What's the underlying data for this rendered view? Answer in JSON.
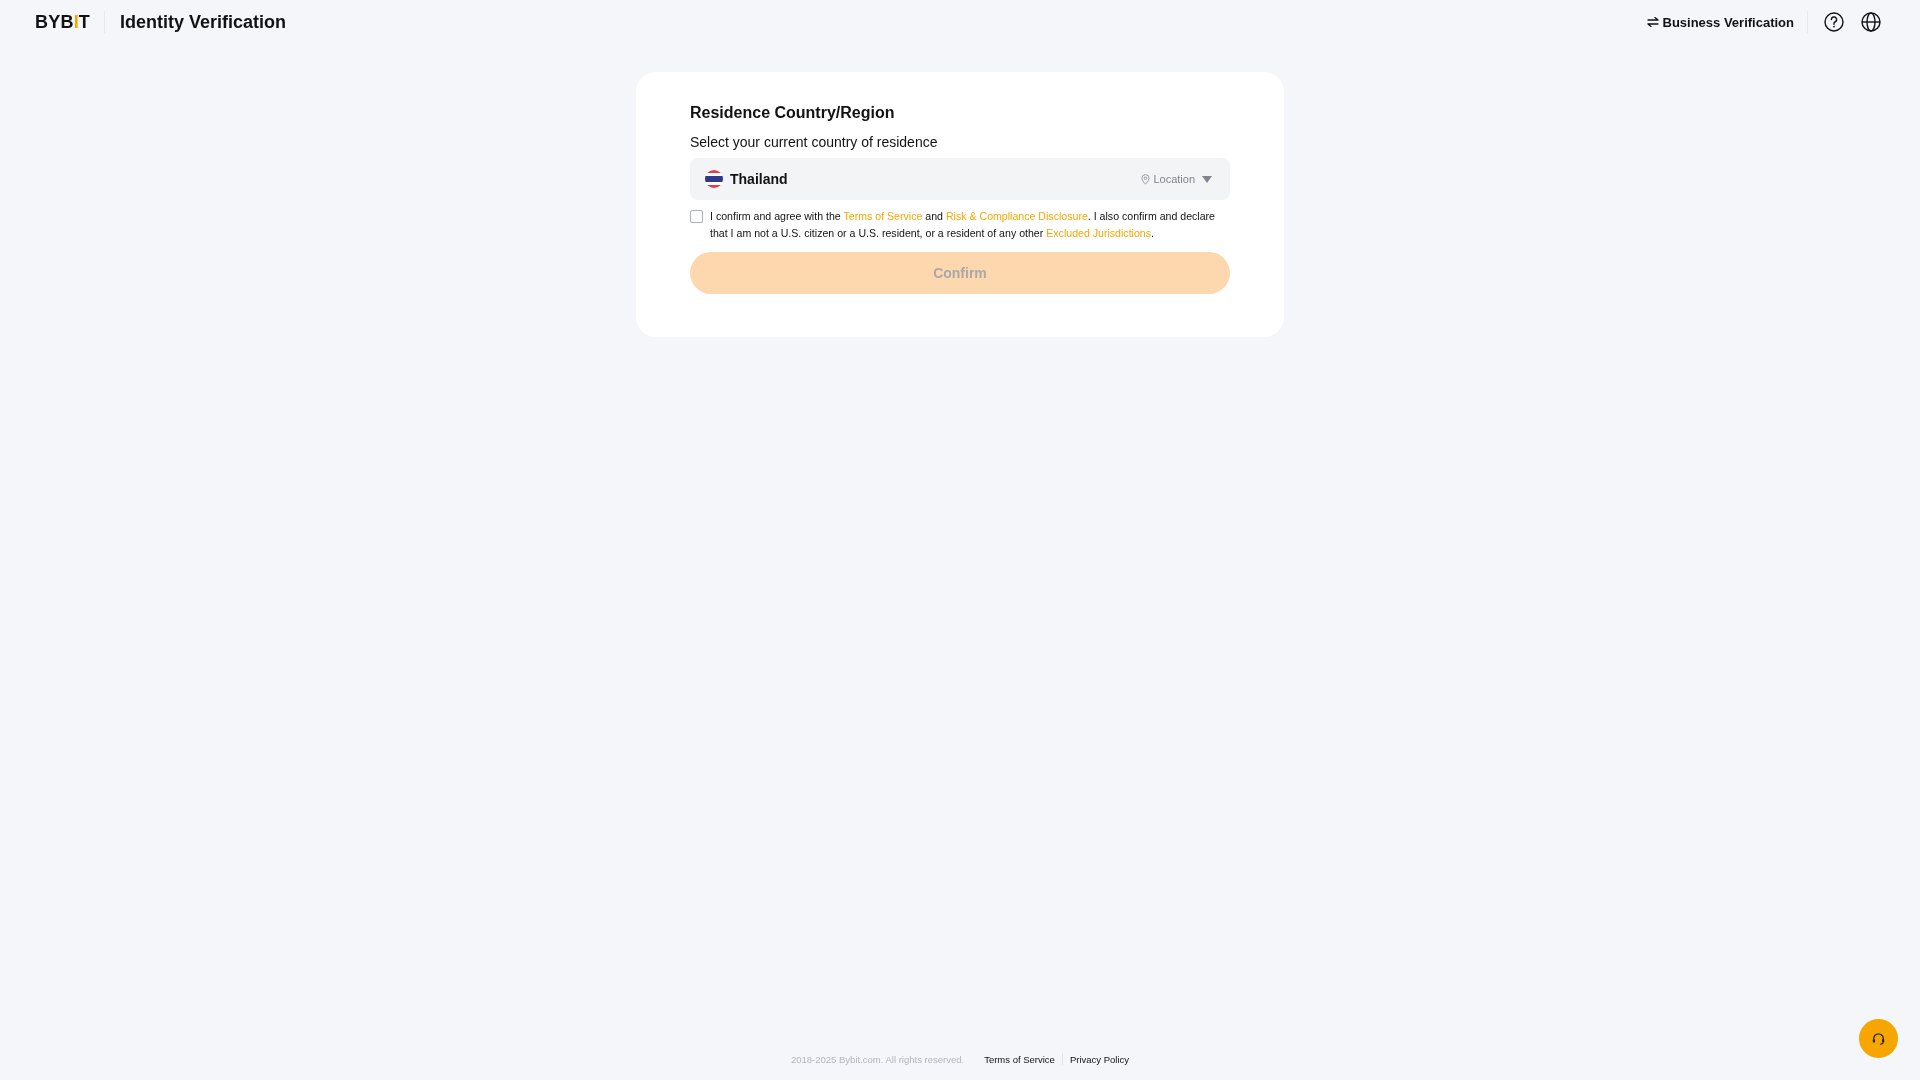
{
  "header": {
    "logo": "BYBIT",
    "title": "Identity Verification",
    "business_link": "Business Verification"
  },
  "card": {
    "title": "Residence Country/Region",
    "subtitle": "Select your current country of residence",
    "country_select": {
      "value": "Thailand",
      "location_label": "Location"
    },
    "agreement": {
      "checked": false,
      "parts": [
        {
          "kind": "text",
          "text": "I confirm and agree with the "
        },
        {
          "kind": "link",
          "text": "Terms of Service"
        },
        {
          "kind": "text",
          "text": " and "
        },
        {
          "kind": "link",
          "text": "Risk & Compliance Disclosure"
        },
        {
          "kind": "text",
          "text": ". I also confirm and declare that I am not a U.S. citizen or a U.S. resident, or a resident of any other "
        },
        {
          "kind": "link",
          "text": "Excluded Jurisdictions"
        },
        {
          "kind": "text",
          "text": "."
        }
      ]
    },
    "confirm_button": {
      "label": "Confirm",
      "disabled": true
    }
  },
  "footer": {
    "copyright": "2018-2025 Bybit.com. All rights reserved.",
    "links": [
      "Terms of Service",
      "Privacy Policy"
    ]
  }
}
